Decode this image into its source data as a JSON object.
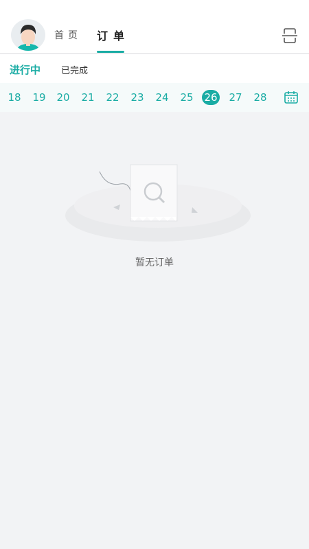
{
  "header": {
    "nav_home": "首页",
    "nav_orders": "订单"
  },
  "status_tabs": {
    "active": "进行中",
    "completed": "已完成"
  },
  "dates": [
    "18",
    "19",
    "20",
    "21",
    "22",
    "23",
    "24",
    "25",
    "26",
    "27",
    "28"
  ],
  "selected_date": "26",
  "empty_state": {
    "message": "暂无订单"
  },
  "colors": {
    "accent": "#1aaca4",
    "background": "#f2f3f5"
  },
  "icons": {
    "avatar": "avatar",
    "scan": "scan-icon",
    "calendar": "calendar-icon",
    "empty": "empty-orders-icon"
  }
}
